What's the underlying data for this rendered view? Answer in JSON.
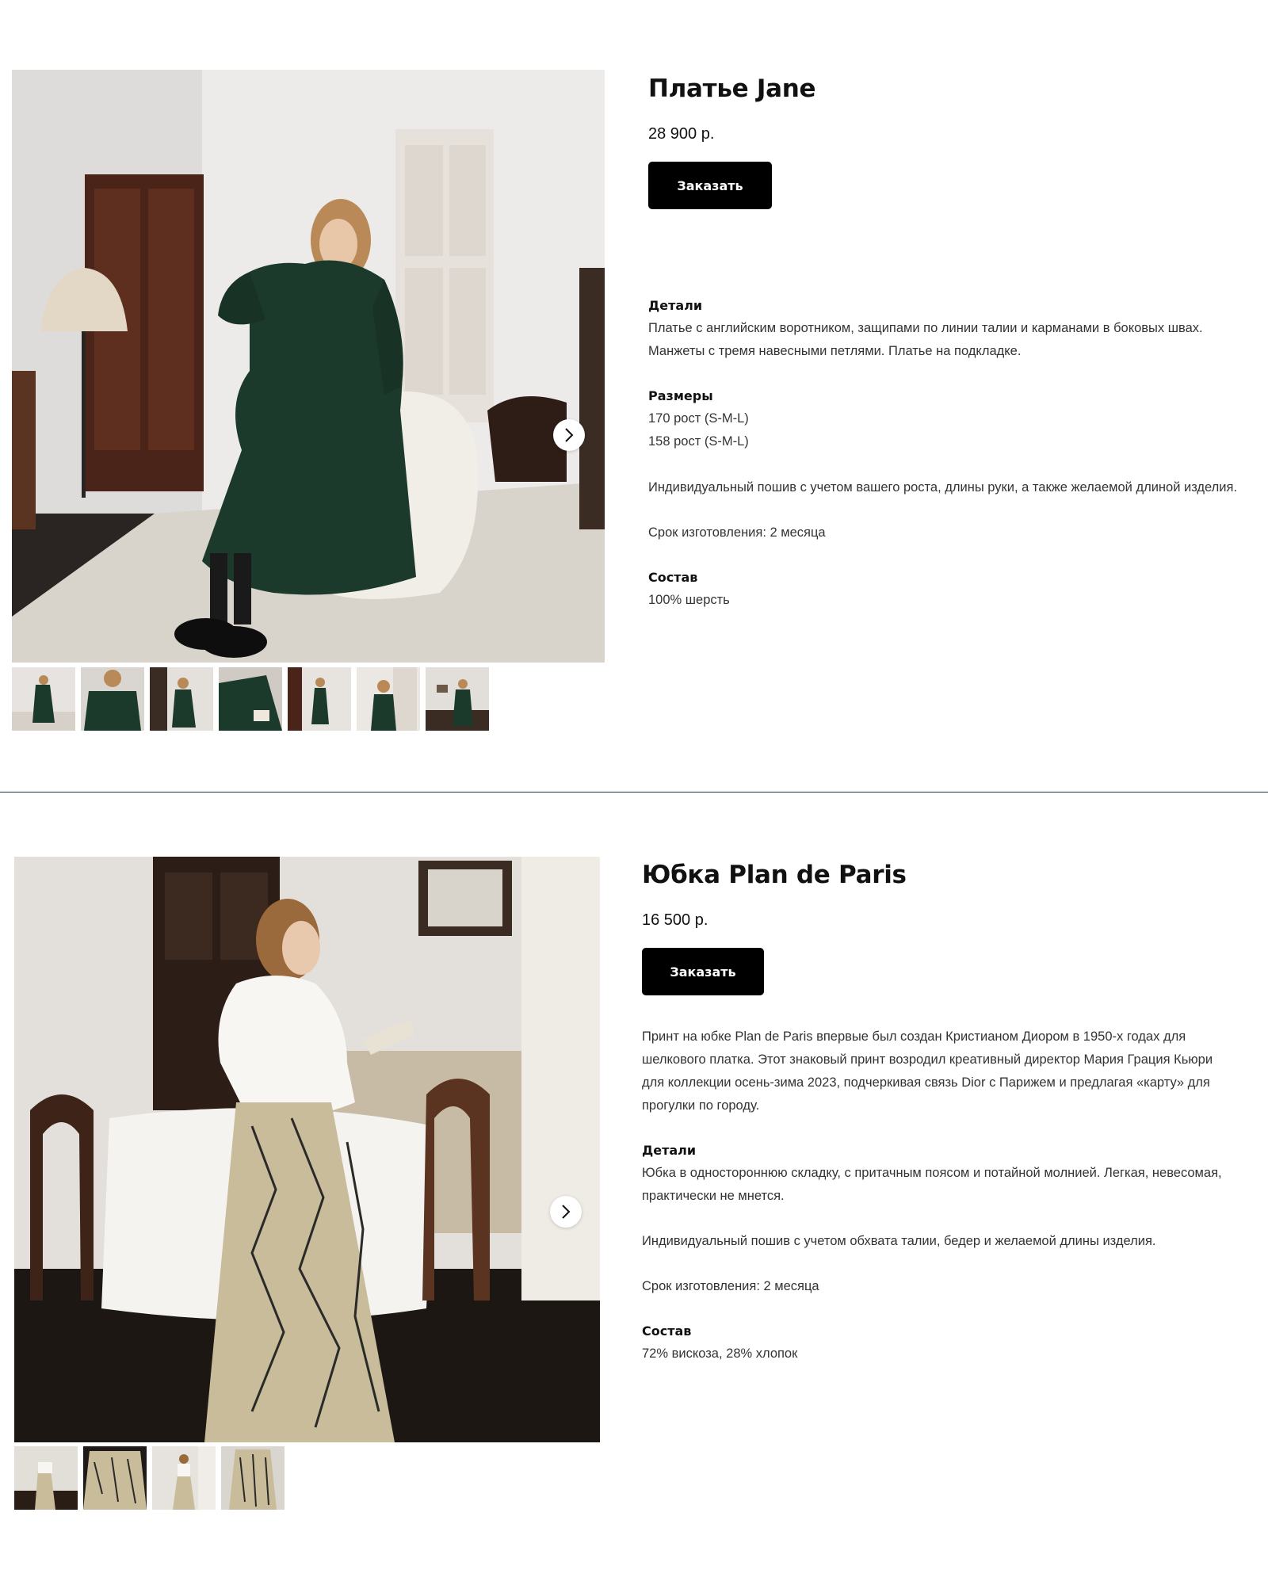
{
  "products": [
    {
      "title": "Платье Jane",
      "price": "28 900 р.",
      "order_label": "Заказать",
      "details_heading": "Детали",
      "details_lines": [
        "Платье с английским воротником, защипами по линии талии и карманами в боковых швах.",
        "Манжеты с тремя навесными петлями. Платье на подкладке."
      ],
      "sizes_heading": "Размеры",
      "sizes": [
        "170 рост (S-M-L)",
        "158 рост (S-M-L)"
      ],
      "custom_note": "Индивидуальный пошив с учетом вашего роста, длины руки, а также желаемой длиной изделия.",
      "lead_time": "Срок изготовления: 2 месяца",
      "composition_heading": "Состав",
      "composition": "100% шерсть",
      "thumb_count": 7
    },
    {
      "title": "Юбка Plan de Paris",
      "price": "16 500 р.",
      "order_label": "Заказать",
      "intro_lines": [
        "Принт на юбке Plan de Paris впервые был создан Кристианом Диором в 1950-х годах для",
        "шелкового платка. Этот знаковый принт возродил креативный директор Мария Грация Кьюри",
        "для коллекции осень-зима 2023, подчеркивая связь Dior с Парижем и предлагая «карту» для",
        "прогулки по городу."
      ],
      "details_heading": "Детали",
      "details_lines": [
        "Юбка в одностороннюю складку, с притачным поясом и потайной молнией. Легкая, невесомая,",
        "практически не мнется."
      ],
      "custom_note": "Индивидуальный пошив с учетом обхвата талии, бедер и желаемой длины изделия.",
      "lead_time": "Срок изготовления: 2 месяца",
      "composition_heading": "Состав",
      "composition": "72% вискоза, 28% хлопок",
      "thumb_count": 4
    }
  ],
  "icons": {
    "next": "chevron-right-icon"
  },
  "colors": {
    "button_bg": "#000000",
    "button_text": "#ffffff",
    "divider": "#1f3340",
    "dress_green": "#1c3a2c"
  }
}
